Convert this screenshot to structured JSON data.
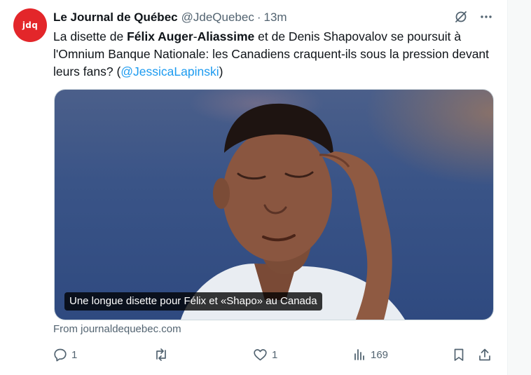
{
  "tweet": {
    "author_name": "Le Journal de Québec",
    "handle": "@JdeQuebec",
    "separator": "·",
    "time": "13m",
    "avatar_text": "jdq",
    "text": {
      "p1": "La disette de ",
      "bold1": "Félix Auger",
      "p2": "-",
      "bold2": "Aliassime",
      "p3": " et de Denis Shapovalov se poursuit à l'Omnium Banque Nationale: les Canadiens craquent-ils sous la pression devant leurs fans? (",
      "mention": "@JessicaLapinski",
      "p4": ")"
    }
  },
  "card": {
    "caption": "Une longue disette pour Félix et «Shapo» au Canada",
    "source": "From journaldequebec.com"
  },
  "actions": {
    "reply_count": "1",
    "repost_count": "",
    "like_count": "1",
    "views_count": "169"
  },
  "icons": {
    "grok": "grok-icon",
    "more": "more-icon",
    "reply": "reply-icon",
    "repost": "repost-icon",
    "like": "heart-icon",
    "views": "views-icon",
    "bookmark": "bookmark-icon",
    "share": "share-icon"
  },
  "colors": {
    "accent": "#1d9bf0",
    "avatar_bg": "#e3262a",
    "muted": "#536471"
  }
}
